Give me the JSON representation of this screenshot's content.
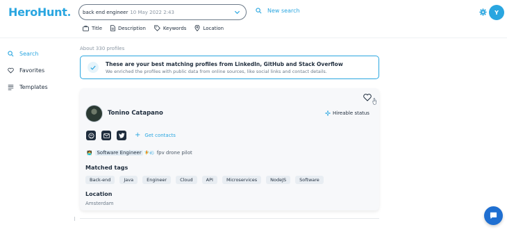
{
  "header": {
    "logo": "HeroHunt",
    "search_query": "back end engineer",
    "search_date": "10 May 2022 2:43",
    "new_search_label": "New search",
    "user_initial": "Y"
  },
  "filters": [
    {
      "label": "Title",
      "icon": "folder-icon"
    },
    {
      "label": "Description",
      "icon": "document-icon"
    },
    {
      "label": "Keywords",
      "icon": "tag-icon"
    },
    {
      "label": "Location",
      "icon": "map-pin-icon"
    }
  ],
  "sidebar": {
    "items": [
      {
        "label": "Search",
        "icon": "search-icon",
        "active": true
      },
      {
        "label": "Favorites",
        "icon": "heart-icon",
        "active": false
      },
      {
        "label": "Templates",
        "icon": "list-icon",
        "active": false
      }
    ]
  },
  "results": {
    "count_text": "About 330 profiles",
    "banner_title": "These are your best matching profiles from LinkedIn, GitHub and Stack Overflow",
    "banner_subtitle": "We enriched the profiles with public data from online sources, like social links and contact details."
  },
  "profile": {
    "name": "Tonino Catapano",
    "hireable_label": "Hireable status",
    "get_contacts_label": "Get contacts",
    "headline_emoji_left": "🧑‍💻",
    "headline_role": "Software Engineer",
    "headline_emoji_right": "🧚💨",
    "headline_extra": "fpv drone pilot",
    "matched_tags_title": "Matched tags",
    "tags": [
      "Back-end",
      "Java",
      "Engineer",
      "Cloud",
      "API",
      "Microservices",
      "NodeJS",
      "Software"
    ],
    "location_title": "Location",
    "location_value": "Amsterdam"
  },
  "colors": {
    "accent": "#2aa6e0",
    "text": "#1f2d3d",
    "chat": "#1f6fd1"
  }
}
